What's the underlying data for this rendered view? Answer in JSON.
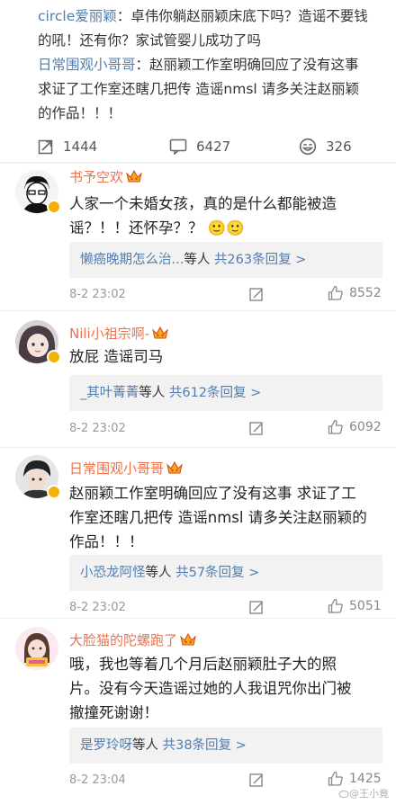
{
  "top_post": {
    "line1_user": "circle爱丽颖",
    "line1_text": "：卓伟你躺赵丽颖床底下吗？造谣不要钱",
    "line2_text": "的吼！还有你？家试管婴儿成功了吗",
    "line3_user": "日常围观小哥哥",
    "line3_text": "：赵丽颖工作室明确回应了没有这事",
    "line4_text": "求证了工作室还瞎几把传 造谣nmsl 请多关注赵丽颖",
    "line5_text": "的作品！！！"
  },
  "actions": {
    "repost_count": "1444",
    "comment_count": "6427",
    "like_count": "326"
  },
  "comments": [
    {
      "username": "书予空欢",
      "line1": "人家一个未婚女孩，真的是什么都能被造",
      "line2": "谣？！！还怀孕？？",
      "emoji": "🙂🙂",
      "reply_user": "懒癌晚期怎么治...",
      "reply_suffix": "等人",
      "reply_count": "共263条回复 >",
      "time": "8-2 23:02",
      "likes": "8552"
    },
    {
      "username": "Nili小祖宗啊-",
      "line1": "放屁 造谣司马",
      "reply_user": "_其叶菁菁",
      "reply_suffix": "等人",
      "reply_count": "共612条回复 >",
      "time": "8-2 23:02",
      "likes": "6092"
    },
    {
      "username": "日常围观小哥哥",
      "line1": "赵丽颖工作室明确回应了没有这事 求证了工",
      "line2": "作室还瞎几把传 造谣nmsl 请多关注赵丽颖的",
      "line3": "作品！！！",
      "reply_user": "小恐龙阿怪",
      "reply_suffix": "等人",
      "reply_count": "共57条回复 >",
      "time": "8-2 23:02",
      "likes": "5051"
    },
    {
      "username": "大脸猫的陀螺跑了",
      "line1": "哦，我也等着几个月后赵丽颖肚子大的照",
      "line2": "片。没有今天造谣过她的人我诅咒你出门被",
      "line3": "撤撞死谢谢！",
      "reply_user": "是罗玲呀",
      "reply_suffix": "等人",
      "reply_count": "共38条回复 >",
      "time": "8-2 23:04",
      "likes": "1425"
    }
  ],
  "watermark": "@王小竟",
  "colors": {
    "username": "#eb7350",
    "link_blue": "#507daf",
    "gold_badge": "#f5b000"
  }
}
